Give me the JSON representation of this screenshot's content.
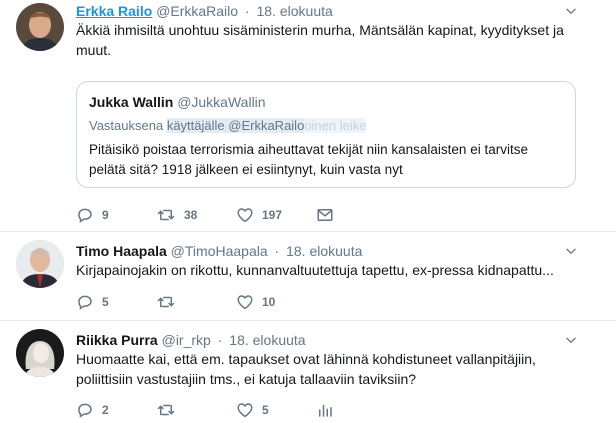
{
  "tweets": [
    {
      "name": "Erkka Railo",
      "handle": "@ErkkaRailo",
      "separator": "·",
      "date": "18. elokuuta",
      "text": "Äkkiä ihmisiltä unohtuu sisäministerin murha, Mäntsälän kapinat, kyyditykset ja muut.",
      "quote": {
        "name": "Jukka Wallin",
        "handle": "@JukkaWallin",
        "reply_prefix": "Vastauksena",
        "reply_user": "käyttäjälle @ErkkaRailo",
        "reply_faded": "oinen leike",
        "text": "Pitäisikö poistaa terrorismia aiheuttavat tekijät niin kansalaisten ei tarvitse pelätä sitä? 1918 jälkeen ei esiintynyt, kuin vasta nyt"
      },
      "replies": "9",
      "retweets": "38",
      "likes": "197"
    },
    {
      "name": "Timo Haapala",
      "handle": "@TimoHaapala",
      "separator": "·",
      "date": "18. elokuuta",
      "text": "Kirjapainojakin on rikottu, kunnanvaltuutettuja tapettu, ex-pressa kidnapattu...",
      "replies": "5",
      "retweets": "",
      "likes": "10"
    },
    {
      "name": "Riikka Purra",
      "handle": "@ir_rkp",
      "separator": "·",
      "date": "18. elokuuta",
      "text": "Huomaatte kai, että em. tapaukset ovat lähinnä kohdistuneet vallanpitäjiin, poliittisiin vastustajiin tms., ei katuja tallaaviin taviksiin?",
      "replies": "2",
      "retweets": "",
      "likes": "5"
    }
  ],
  "icons": {
    "reply": "reply-icon",
    "retweet": "retweet-icon",
    "like": "heart-icon",
    "dm": "envelope-icon",
    "analytics": "analytics-icon",
    "menu": "chevron-down-icon"
  },
  "colors": {
    "text": "#14171a",
    "secondary": "#657786",
    "link": "#1b95e0",
    "border": "#e6ecf0"
  }
}
